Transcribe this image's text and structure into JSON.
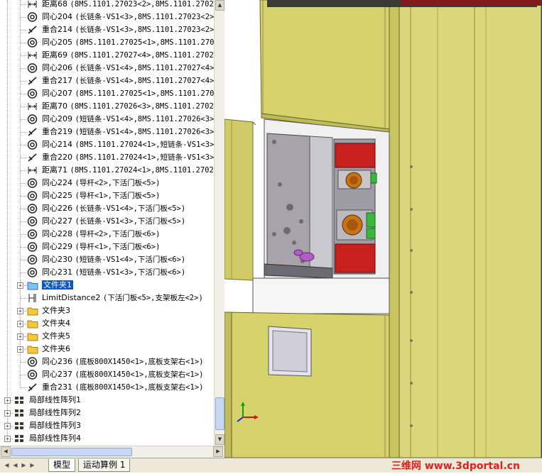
{
  "tree": {
    "rows": [
      {
        "icon": "distance-icon",
        "name": "距离68",
        "rest": "(8MS.1101.27023<2>,8MS.1101.27022"
      },
      {
        "icon": "concentric-icon",
        "name": "同心204",
        "rest": "(长链条-VS1<3>,8MS.1101.27023<2>"
      },
      {
        "icon": "coincident-icon",
        "name": "重合214",
        "rest": "(长链条-VS1<3>,8MS.1101.27023<2>"
      },
      {
        "icon": "concentric-icon",
        "name": "同心205",
        "rest": "(8MS.1101.27025<1>,8MS.1101.2702"
      },
      {
        "icon": "distance-icon",
        "name": "距离69",
        "rest": "(8MS.1101.27027<4>,8MS.1101.27025"
      },
      {
        "icon": "concentric-icon",
        "name": "同心206",
        "rest": "(长链条-VS1<4>,8MS.1101.27027<4>"
      },
      {
        "icon": "coincident-icon",
        "name": "重合217",
        "rest": "(长链条-VS1<4>,8MS.1101.27027<4>"
      },
      {
        "icon": "concentric-icon",
        "name": "同心207",
        "rest": "(8MS.1101.27025<1>,8MS.1101.2702"
      },
      {
        "icon": "distance-icon",
        "name": "距离70",
        "rest": "(8MS.1101.27026<3>,8MS.1101.27027"
      },
      {
        "icon": "concentric-icon",
        "name": "同心209",
        "rest": "(短链条-VS1<4>,8MS.1101.27026<3>"
      },
      {
        "icon": "coincident-icon",
        "name": "重合219",
        "rest": "(短链条-VS1<4>,8MS.1101.27026<3>"
      },
      {
        "icon": "concentric-icon",
        "name": "同心214",
        "rest": "(8MS.1101.27024<1>,短链条-VS1<3>"
      },
      {
        "icon": "coincident-icon",
        "name": "重合220",
        "rest": "(8MS.1101.27024<1>,短链条-VS1<3>"
      },
      {
        "icon": "distance-icon",
        "name": "距离71",
        "rest": "(8MS.1101.27024<1>,8MS.1101.27022"
      },
      {
        "icon": "concentric-icon",
        "name": "同心224",
        "rest": "(导杆<2>,下活门板<5>)"
      },
      {
        "icon": "concentric-icon",
        "name": "同心225",
        "rest": "(导杆<1>,下活门板<5>)"
      },
      {
        "icon": "concentric-icon",
        "name": "同心226",
        "rest": "(长链条-VS1<4>,下活门板<5>)"
      },
      {
        "icon": "concentric-icon",
        "name": "同心227",
        "rest": "(长链条-VS1<3>,下活门板<5>)"
      },
      {
        "icon": "concentric-icon",
        "name": "同心228",
        "rest": "(导杆<2>,下活门板<6>)"
      },
      {
        "icon": "concentric-icon",
        "name": "同心229",
        "rest": "(导杆<1>,下活门板<6>)"
      },
      {
        "icon": "concentric-icon",
        "name": "同心230",
        "rest": "(短链条-VS1<4>,下活门板<6>)"
      },
      {
        "icon": "concentric-icon",
        "name": "同心231",
        "rest": "(短链条-VS1<3>,下活门板<6>)"
      },
      {
        "icon": "folder-open-icon",
        "name": "文件夹1",
        "rest": ""
      },
      {
        "icon": "limit-distance-icon",
        "name": "LimitDistance2",
        "rest": "(下活门板<5>,支架板左<2>)"
      },
      {
        "icon": "folder-icon",
        "name": "文件夹3",
        "rest": ""
      },
      {
        "icon": "folder-icon",
        "name": "文件夹4",
        "rest": ""
      },
      {
        "icon": "folder-icon",
        "name": "文件夹5",
        "rest": ""
      },
      {
        "icon": "folder-icon",
        "name": "文件夹6",
        "rest": ""
      },
      {
        "icon": "concentric-icon",
        "name": "同心236",
        "rest": "(底板800X1450<1>,底板支架右<1>)"
      },
      {
        "icon": "concentric-icon",
        "name": "同心237",
        "rest": "(底板800X1450<1>,底板支架右<1>)"
      },
      {
        "icon": "coincident-icon",
        "name": "重合231",
        "rest": "(底板800X1450<1>,底板支架右<1>)"
      },
      {
        "icon": "linear-pattern-icon",
        "name": "局部线性阵列1",
        "rest": ""
      },
      {
        "icon": "linear-pattern-icon",
        "name": "局部线性阵列2",
        "rest": ""
      },
      {
        "icon": "linear-pattern-icon",
        "name": "局部线性阵列3",
        "rest": ""
      },
      {
        "icon": "linear-pattern-icon",
        "name": "局部线性阵列4",
        "rest": ""
      }
    ]
  },
  "tabs": {
    "model": "模型",
    "motion_study": "运动算例 1"
  },
  "watermark": "三维网 www.3dportal.cn",
  "colors": {
    "selection": "#0a58c8",
    "cabinet_yellow": "#d4d06a",
    "component_red": "#c8201c",
    "component_green": "#3bb83b",
    "watermark_red": "#e0201c"
  }
}
